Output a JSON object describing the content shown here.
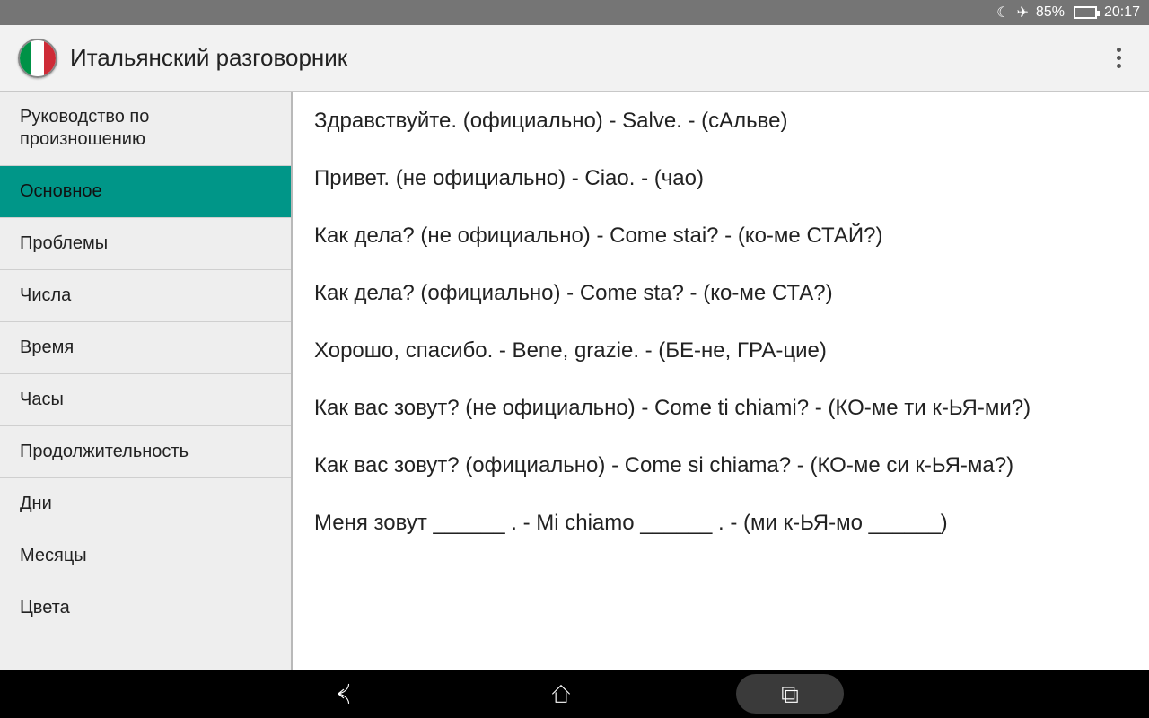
{
  "status": {
    "battery_pct": "85%",
    "battery_fill": 85,
    "time": "20:17"
  },
  "appbar": {
    "title": "Итальянский разговорник"
  },
  "sidebar": {
    "items": [
      {
        "label": "Руководство по произношению",
        "selected": false
      },
      {
        "label": "Основное",
        "selected": true
      },
      {
        "label": "Проблемы",
        "selected": false
      },
      {
        "label": "Числа",
        "selected": false
      },
      {
        "label": "Время",
        "selected": false
      },
      {
        "label": "Часы",
        "selected": false
      },
      {
        "label": "Продолжительность",
        "selected": false
      },
      {
        "label": "Дни",
        "selected": false
      },
      {
        "label": "Месяцы",
        "selected": false
      },
      {
        "label": "Цвета",
        "selected": false
      }
    ]
  },
  "phrases": [
    "Здравствуйте. (официально) - Salve. - (сАльве)",
    "Привет. (не официально) - Ciao. - (чао)",
    "Как дела? (не официально) - Come stai? - (ко-ме СТАЙ?)",
    "Как дела? (официально) - Come sta? - (ко-ме СТА?)",
    "Хорошо, спасибо. - Bene, grazie. - (БЕ-не, ГРА-цие)",
    "Как вас зовут? (не официально) - Come ti chiami? - (КО-ме ти к-ЬЯ-ми?)",
    "Как вас зовут? (официально) - Come si chiama? - (КО-ме си к-ЬЯ-ма?)",
    "Меня зовут ______ . - Mi chiamo ______ . - (ми к-ЬЯ-мо ______)"
  ]
}
